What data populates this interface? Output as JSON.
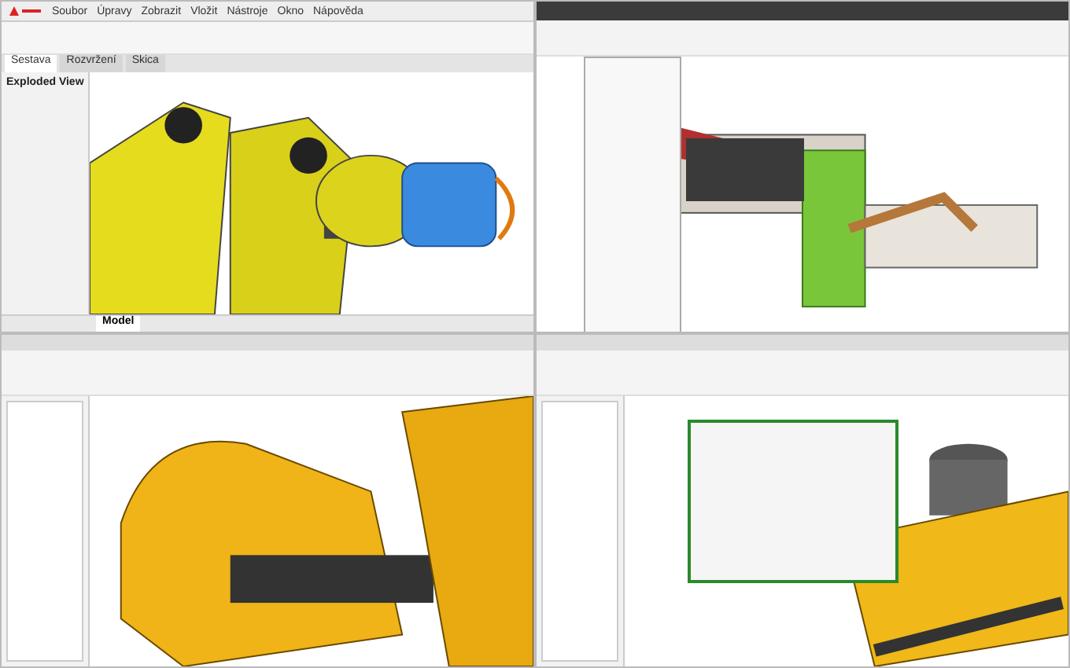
{
  "top_left": {
    "menu": [
      "Soubor",
      "Úpravy",
      "Zobrazit",
      "Vložit",
      "Nástroje",
      "Okno",
      "Nápověda"
    ],
    "tabs": [
      {
        "label": "Sestava",
        "selected": true
      },
      {
        "label": "Rozvržení",
        "selected": false
      },
      {
        "label": "Skica",
        "selected": false
      }
    ],
    "panel_title": "Exploded View",
    "bottom_tabs": [
      {
        "label": "Model",
        "selected": true
      }
    ]
  }
}
